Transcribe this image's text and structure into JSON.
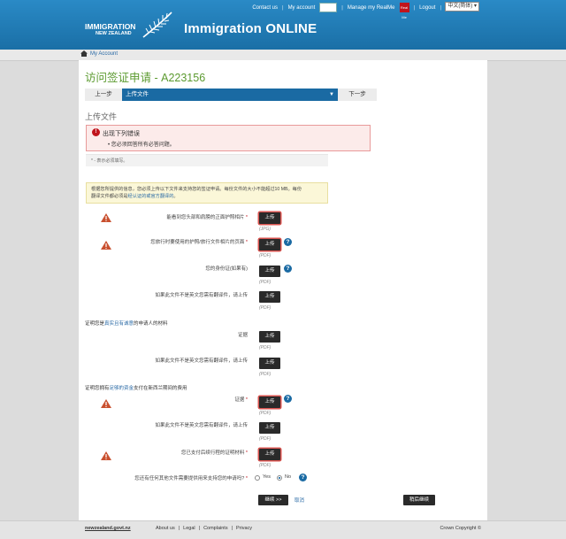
{
  "header": {
    "top_links": {
      "contact": "Contact us",
      "account": "My account",
      "realme": "Manage my RealMe",
      "realme_badge": "Real Me",
      "logout": "Logout",
      "language": "中文(简体)"
    },
    "logo_main": "IMMIGRATION",
    "logo_sub": "NEW ZEALAND",
    "app_title": "Immigration ONLINE"
  },
  "breadcrumb": {
    "label": "My Account"
  },
  "page": {
    "title": "访问签证申请 - A223156",
    "wizard": {
      "prev": "上一步",
      "current": "上传文件",
      "next": "下一步"
    },
    "section_title": "上传文件",
    "error": {
      "title": "出现下列错误",
      "item": "您必须回答所有必答问题。"
    },
    "required_note": "* - 表示必须填写。",
    "info_text_1": "根据您所提供的信息，您必须上传以下文件来支持您的签证申请。每份文件的大小不能超过10 MB。每份",
    "info_text_2": "翻译文件都必须是",
    "info_link": "经认证的或官方翻译的",
    "info_text_3": "。"
  },
  "uploads": [
    {
      "label": "能看到您头部和肩膀的正面护照相片",
      "required": true,
      "warning": true,
      "format": "(JPG)",
      "help": false,
      "button": "上传"
    },
    {
      "label": "您旅行时要使用的护照/旅行文件相片的页面",
      "required": true,
      "warning": true,
      "format": "(PDF)",
      "help": true,
      "button": "上传"
    },
    {
      "label": "您的身份证(如果有)",
      "required": false,
      "warning": false,
      "format": "(PDF)",
      "help": true,
      "button": "上传"
    },
    {
      "label": "如果此文件不是英文您需有翻译件，请上传",
      "required": false,
      "warning": false,
      "format": "(PDF)",
      "help": false,
      "button": "上传"
    }
  ],
  "group1": {
    "pre": "证明您是",
    "link": "真实且有诚意",
    "post": "的申请人的材料"
  },
  "group1_uploads": [
    {
      "label": "证据",
      "format": "(PDF)",
      "button": "上传"
    },
    {
      "label": "如果此文件不是英文您需有翻译件，请上传",
      "format": "(PDF)",
      "button": "上传"
    }
  ],
  "group2": {
    "pre": "证明您拥有",
    "link": "足够的资金",
    "post": "支付在新西兰期间的费用"
  },
  "group2_uploads": [
    {
      "label": "证据",
      "required": true,
      "warning": true,
      "format": "(PDF)",
      "help": true,
      "button": "上传"
    },
    {
      "label": "如果此文件不是英文您需有翻译件，请上传",
      "required": false,
      "warning": false,
      "format": "(PDF)",
      "help": false,
      "button": "上传"
    },
    {
      "label": "您已支付后续行程的证明材料",
      "required": true,
      "warning": true,
      "format": "(PDF)",
      "help": false,
      "button": "上传"
    }
  ],
  "other_question": {
    "label": "您还有任何其他文件需要提供用来支持您的申请吗?",
    "required": true,
    "yes": "Yes",
    "no": "No",
    "selected": "No"
  },
  "actions": {
    "continue": "继续 >>",
    "cancel": "取消",
    "save_later": "稍后继续"
  },
  "footer": {
    "site": "newzealand.govt.nz",
    "links": [
      "About us",
      "Legal",
      "Complaints",
      "Privacy"
    ],
    "copyright": "Crown Copyright ©"
  },
  "colors": {
    "header_blue": "#1a6fa6",
    "title_green": "#5b9a2f",
    "error_red": "#c0141c",
    "accent_blue": "#1a6aa3"
  }
}
